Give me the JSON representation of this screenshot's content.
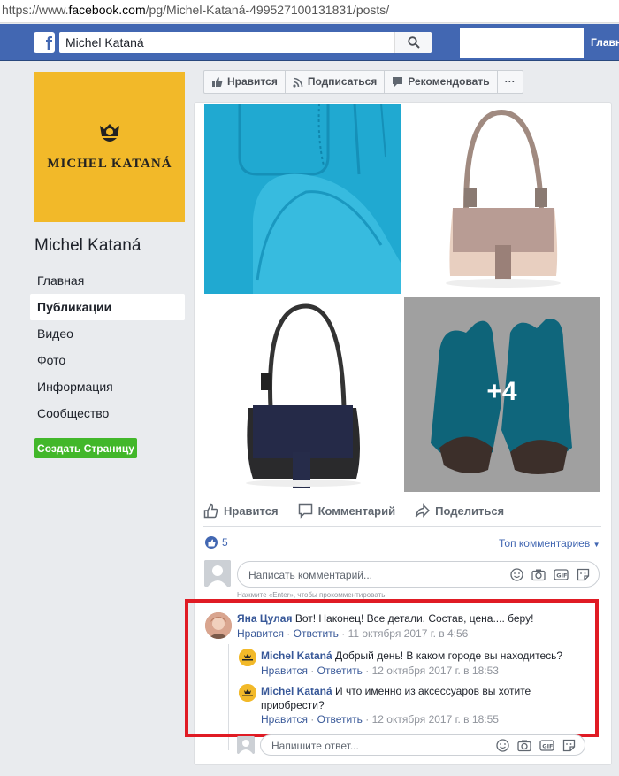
{
  "browser": {
    "url_prefix": "https://www.",
    "url_domain": "facebook.com",
    "url_suffix": "/pg/Michel-Kataná-499527100131831/posts/"
  },
  "topbar": {
    "logo": "f",
    "search_value": "Michel Kataná",
    "home_label": "Главн"
  },
  "page": {
    "name": "Michel Kataná",
    "logo_text": "MICHEL KATANÁ",
    "nav": [
      "Главная",
      "Публикации",
      "Видео",
      "Фото",
      "Информация",
      "Сообщество"
    ],
    "create_page": "Создать Страницу"
  },
  "actions": {
    "like": "Нравится",
    "follow": "Подписаться",
    "recommend": "Рекомендовать",
    "more": "···"
  },
  "post": {
    "more_photos": "+4",
    "like": "Нравится",
    "comment": "Комментарий",
    "share": "Поделиться",
    "likes_count": "5",
    "top_comments": "Топ комментариев",
    "comment_placeholder": "Написать комментарий...",
    "enter_hint": "Нажмите «Еnter», чтобы прокомментировать.",
    "reply_placeholder": "Напишите ответ..."
  },
  "comments": [
    {
      "author": "Яна Цулая",
      "text": "Вот! Наконец! Все детали. Состав, цена.... беру!",
      "like": "Нравится",
      "reply": "Ответить",
      "time": "11 октября 2017 г. в 4:56"
    },
    {
      "author": "Michel Kataná",
      "text": "Добрый день! В каком городе вы находитесь?",
      "like": "Нравится",
      "reply": "Ответить",
      "time": "12 октября 2017 г. в 18:53"
    },
    {
      "author": "Michel Kataná",
      "text_line1": "И что именно из аксессуаров вы хотите",
      "text_line2": "приобрести?",
      "like": "Нравится",
      "reply": "Ответить",
      "time": "12 октября 2017 г. в 18:55"
    }
  ],
  "meta_sep": " · ",
  "colors": {
    "brand_blue": "#4267b2",
    "link": "#385898",
    "highlight": "#e01b24",
    "logo_bg": "#f2b929",
    "create_btn": "#42b72a"
  }
}
